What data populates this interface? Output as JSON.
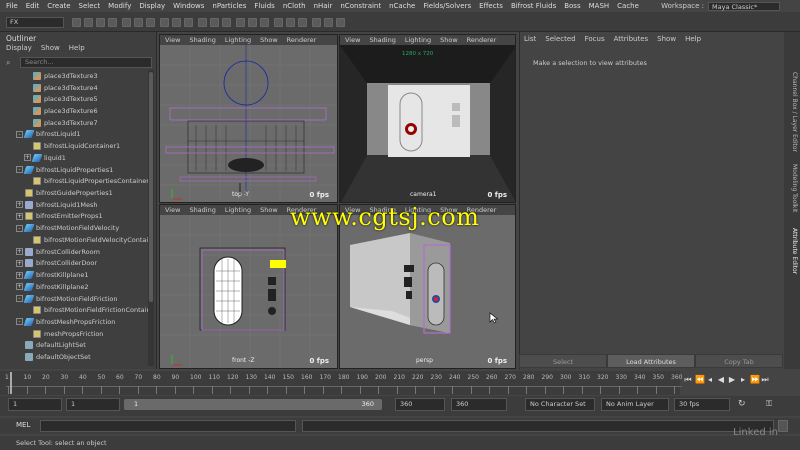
{
  "menubar": [
    "File",
    "Edit",
    "Create",
    "Select",
    "Modify",
    "Display",
    "Windows",
    "nParticles",
    "Fluids",
    "nCloth",
    "nHair",
    "nConstraint",
    "nCache",
    "Fields/Solvers",
    "Effects",
    "Bifrost Fluids",
    "Boss",
    "MASH",
    "Cache"
  ],
  "workspace": {
    "label": "Workspace :",
    "value": "Maya Classic*"
  },
  "mode": "FX",
  "outliner": {
    "title": "Outliner",
    "menu": [
      "Display",
      "Show",
      "Help"
    ],
    "search_placeholder": "Search...",
    "items": [
      {
        "label": "place3dTexture3",
        "indent": 2,
        "icon": "tex",
        "exp": ""
      },
      {
        "label": "place3dTexture4",
        "indent": 2,
        "icon": "tex",
        "exp": ""
      },
      {
        "label": "place3dTexture5",
        "indent": 2,
        "icon": "tex",
        "exp": ""
      },
      {
        "label": "place3dTexture6",
        "indent": 2,
        "icon": "tex",
        "exp": ""
      },
      {
        "label": "place3dTexture7",
        "indent": 2,
        "icon": "tex",
        "exp": ""
      },
      {
        "label": "bifrostLiquid1",
        "indent": 1,
        "icon": "liq",
        "exp": "-"
      },
      {
        "label": "bifrostLiquidContainer1",
        "indent": 2,
        "icon": "cont",
        "exp": ""
      },
      {
        "label": "liquid1",
        "indent": 2,
        "icon": "liq",
        "exp": "+"
      },
      {
        "label": "bifrostLiquidProperties1",
        "indent": 1,
        "icon": "liq",
        "exp": "-"
      },
      {
        "label": "bifrostLiquidPropertiesContainer1",
        "indent": 2,
        "icon": "cont",
        "exp": ""
      },
      {
        "label": "bifrostGuideProperties1",
        "indent": 1,
        "icon": "cont",
        "exp": ""
      },
      {
        "label": "bifrostLiquid1Mesh",
        "indent": 1,
        "icon": "mesh",
        "exp": "+"
      },
      {
        "label": "bifrostEmitterProps1",
        "indent": 1,
        "icon": "cont",
        "exp": "+"
      },
      {
        "label": "bifrostMotionFieldVelocity",
        "indent": 1,
        "icon": "liq",
        "exp": "-"
      },
      {
        "label": "bifrostMotionFieldVelocityContain",
        "indent": 2,
        "icon": "cont",
        "exp": ""
      },
      {
        "label": "bifrostColliderRoom",
        "indent": 1,
        "icon": "mesh",
        "exp": "+"
      },
      {
        "label": "bifrostColliderDoor",
        "indent": 1,
        "icon": "mesh",
        "exp": "+"
      },
      {
        "label": "bifrostKillplane1",
        "indent": 1,
        "icon": "liq",
        "exp": "+"
      },
      {
        "label": "bifrostKillplane2",
        "indent": 1,
        "icon": "liq",
        "exp": "+"
      },
      {
        "label": "bifrostMotionFieldFriction",
        "indent": 1,
        "icon": "liq",
        "exp": "-"
      },
      {
        "label": "bifrostMotionFieldFrictionContain",
        "indent": 2,
        "icon": "cont",
        "exp": ""
      },
      {
        "label": "bifrostMeshPropsFriction",
        "indent": 1,
        "icon": "liq",
        "exp": "-"
      },
      {
        "label": "meshPropsFriction",
        "indent": 2,
        "icon": "cont",
        "exp": ""
      },
      {
        "label": "defaultLightSet",
        "indent": 1,
        "icon": "set",
        "exp": ""
      },
      {
        "label": "defaultObjectSet",
        "indent": 1,
        "icon": "set",
        "exp": ""
      }
    ]
  },
  "viewport_menu": [
    "View",
    "Shading",
    "Lighting",
    "Show",
    "Renderer"
  ],
  "viewports": {
    "top": {
      "label": "top -Y",
      "fps": "0 fps"
    },
    "camera": {
      "label": "camera1",
      "fps": "0 fps",
      "resolution": "1280 x 720"
    },
    "front": {
      "label": "front -Z",
      "fps": "0 fps"
    },
    "persp": {
      "label": "persp",
      "fps": "0 fps"
    }
  },
  "attribute_editor": {
    "menu": [
      "List",
      "Selected",
      "Focus",
      "Attributes",
      "Show",
      "Help"
    ],
    "message": "Make a selection to view attributes",
    "buttons": [
      "Select",
      "Load Attributes",
      "Copy Tab"
    ]
  },
  "side_tabs": [
    "Channel Box / Layer Editor",
    "Modeling Toolkit",
    "Attribute Editor"
  ],
  "timeline": {
    "ticks": [
      "1",
      "10",
      "20",
      "30",
      "40",
      "50",
      "60",
      "70",
      "80",
      "90",
      "100",
      "110",
      "120",
      "130",
      "140",
      "150",
      "160",
      "170",
      "180",
      "190",
      "200",
      "210",
      "220",
      "230",
      "240",
      "250",
      "260",
      "270",
      "280",
      "290",
      "300",
      "310",
      "320",
      "330",
      "340",
      "350",
      "360"
    ],
    "current": "1"
  },
  "range": {
    "start": "1",
    "anim_start": "1",
    "range_start": "1",
    "range_end": "360",
    "anim_end": "360",
    "end": "360",
    "character_set": "No Character Set",
    "anim_layer": "No Anim Layer",
    "fps": "30 fps"
  },
  "command": {
    "lang": "MEL"
  },
  "help_line": "Select Tool: select an object",
  "watermark": "www.cgtsj.com",
  "corner_logo": "Linked in"
}
